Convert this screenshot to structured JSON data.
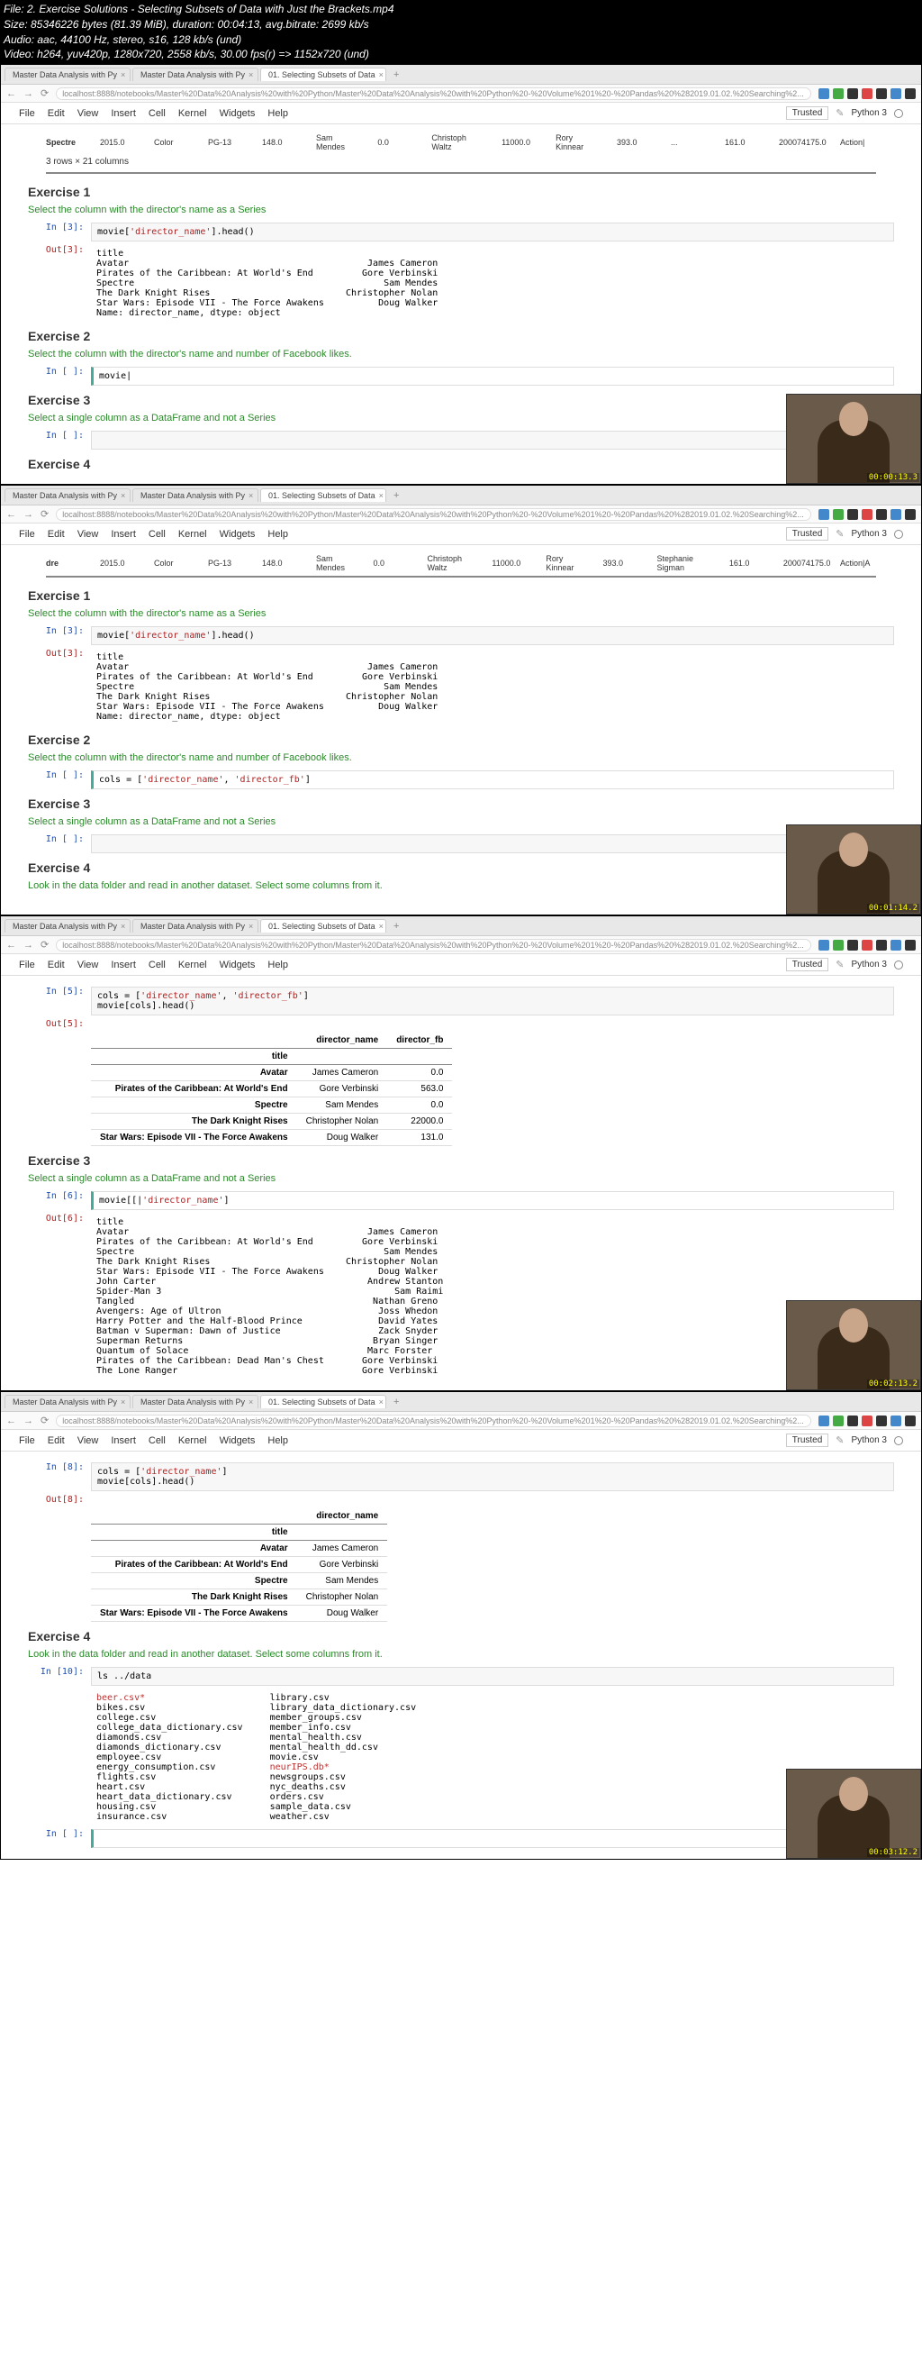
{
  "meta": {
    "file": "File: 2. Exercise Solutions - Selecting Subsets of Data with Just the Brackets.mp4",
    "size": "Size: 85346226 bytes (81.39 MiB), duration: 00:04:13, avg.bitrate: 2699 kb/s",
    "audio": "Audio: aac, 44100 Hz, stereo, s16, 128 kb/s (und)",
    "video": "Video: h264, yuv420p, 1280x720, 2558 kb/s, 30.00 fps(r) => 1152x720 (und)"
  },
  "tabs": {
    "t1": "Master Data Analysis with Py",
    "t2": "Master Data Analysis with Py",
    "t3": "01. Selecting Subsets of Data",
    "add": "+"
  },
  "url": "localhost:8888/notebooks/Master%20Data%20Analysis%20with%20Python/Master%20Data%20Analysis%20with%20Python%20-%20Volume%201%20-%20Pandas%20%282019.01.02.%20Searching%2...",
  "menu": {
    "file": "File",
    "edit": "Edit",
    "view": "View",
    "insert": "Insert",
    "cell": "Cell",
    "kernel": "Kernel",
    "widgets": "Widgets",
    "help": "Help",
    "trusted": "Trusted",
    "python": "Python 3"
  },
  "df_row1": {
    "name": "Spectre",
    "year": "2015.0",
    "color": "Color",
    "rating": "PG-13",
    "v1": "148.0",
    "director": "Sam Mendes",
    "v2": "0.0",
    "actor1": "Christoph Waltz",
    "v3": "11000.0",
    "actor2": "Rory Kinnear",
    "v4": "393.0",
    "dots": "...",
    "v5": "161.0",
    "gross": "200074175.0",
    "genre": "Action|"
  },
  "df_row2": {
    "name": "dre",
    "year": "2015.0",
    "color": "Color",
    "rating": "PG-13",
    "v1": "148.0",
    "director": "Sam Mendes",
    "v2": "0.0",
    "actor1": "Christoph Waltz",
    "v3": "11000.0",
    "actor2": "Rory Kinnear",
    "v4": "393.0",
    "actor3": "Stephanie Sigman",
    "v5": "161.0",
    "gross": "200074175.0",
    "genre": "Action|A"
  },
  "shape": "3 rows × 21 columns",
  "ex1": {
    "title": "Exercise 1",
    "sub": "Select the column with the director's name as a Series"
  },
  "ex2": {
    "title": "Exercise 2",
    "sub": "Select the column with the director's name and number of Facebook likes."
  },
  "ex3": {
    "title": "Exercise 3",
    "sub": "Select a single column as a DataFrame and not a Series"
  },
  "ex4": {
    "title": "Exercise 4",
    "sub": "Look in the data folder and read in another dataset. Select some columns from it."
  },
  "prompts": {
    "in3": "In [3]:",
    "out3": "Out[3]:",
    "in_": "In [ ]:",
    "in5": "In [5]:",
    "out5": "Out[5]:",
    "in6": "In [6]:",
    "out6": "Out[6]:",
    "in8": "In [8]:",
    "out8": "Out[8]:",
    "in10": "In [10]:"
  },
  "code": {
    "c3": "movie['director_name'].head()",
    "c_movie": "movie|",
    "c_cols2": "cols = ['director_name', 'director_fb']",
    "c5": "cols = ['director_name', 'director_fb']\nmovie[cols].head()",
    "c6": "movie[[|'director_name']",
    "c8": "cols = ['director_name']\nmovie[cols].head()",
    "c10": "ls ../data"
  },
  "out3_text": "title\nAvatar                                            James Cameron\nPirates of the Caribbean: At World's End         Gore Verbinski\nSpectre                                              Sam Mendes\nThe Dark Knight Rises                         Christopher Nolan\nStar Wars: Episode VII - The Force Awakens          Doug Walker\nName: director_name, dtype: object",
  "out6_text": "title\nAvatar                                            James Cameron\nPirates of the Caribbean: At World's End         Gore Verbinski\nSpectre                                              Sam Mendes\nThe Dark Knight Rises                         Christopher Nolan\nStar Wars: Episode VII - The Force Awakens          Doug Walker\nJohn Carter                                       Andrew Stanton\nSpider-Man 3                                           Sam Raimi\nTangled                                            Nathan Greno\nAvengers: Age of Ultron                             Joss Whedon\nHarry Potter and the Half-Blood Prince              David Yates\nBatman v Superman: Dawn of Justice                  Zack Snyder\nSuperman Returns                                   Bryan Singer\nQuantum of Solace                                 Marc Forster\nPirates of the Caribbean: Dead Man's Chest       Gore Verbinski\nThe Lone Ranger                                  Gore Verbinski",
  "table5": {
    "h1": "director_name",
    "h2": "director_fb",
    "idx": "title",
    "rows": [
      {
        "t": "Avatar",
        "d": "James Cameron",
        "f": "0.0"
      },
      {
        "t": "Pirates of the Caribbean: At World's End",
        "d": "Gore Verbinski",
        "f": "563.0"
      },
      {
        "t": "Spectre",
        "d": "Sam Mendes",
        "f": "0.0"
      },
      {
        "t": "The Dark Knight Rises",
        "d": "Christopher Nolan",
        "f": "22000.0"
      },
      {
        "t": "Star Wars: Episode VII - The Force Awakens",
        "d": "Doug Walker",
        "f": "131.0"
      }
    ]
  },
  "table8": {
    "h1": "director_name",
    "idx": "title",
    "rows": [
      {
        "t": "Avatar",
        "d": "James Cameron"
      },
      {
        "t": "Pirates of the Caribbean: At World's End",
        "d": "Gore Verbinski"
      },
      {
        "t": "Spectre",
        "d": "Sam Mendes"
      },
      {
        "t": "The Dark Knight Rises",
        "d": "Christopher Nolan"
      },
      {
        "t": "Star Wars: Episode VII - The Force Awakens",
        "d": "Doug Walker"
      }
    ]
  },
  "ls": {
    "col1": [
      "beer.csv*",
      "bikes.csv",
      "college.csv",
      "college_data_dictionary.csv",
      "diamonds.csv",
      "diamonds_dictionary.csv",
      "employee.csv",
      "energy_consumption.csv",
      "flights.csv",
      "heart.csv",
      "heart_data_dictionary.csv",
      "housing.csv",
      "insurance.csv"
    ],
    "col2": [
      "library.csv",
      "library_data_dictionary.csv",
      "member_groups.csv",
      "member_info.csv",
      "mental_health.csv",
      "mental_health_dd.csv",
      "movie.csv",
      "neurIPS.db*",
      "newsgroups.csv",
      "nyc_deaths.csv",
      "orders.csv",
      "sample_data.csv",
      "weather.csv"
    ]
  },
  "ts": {
    "t1": "00:00:13.3",
    "t2": "00:01:14.2",
    "t3": "00:02:13.2",
    "t4": "00:03:12.2"
  }
}
